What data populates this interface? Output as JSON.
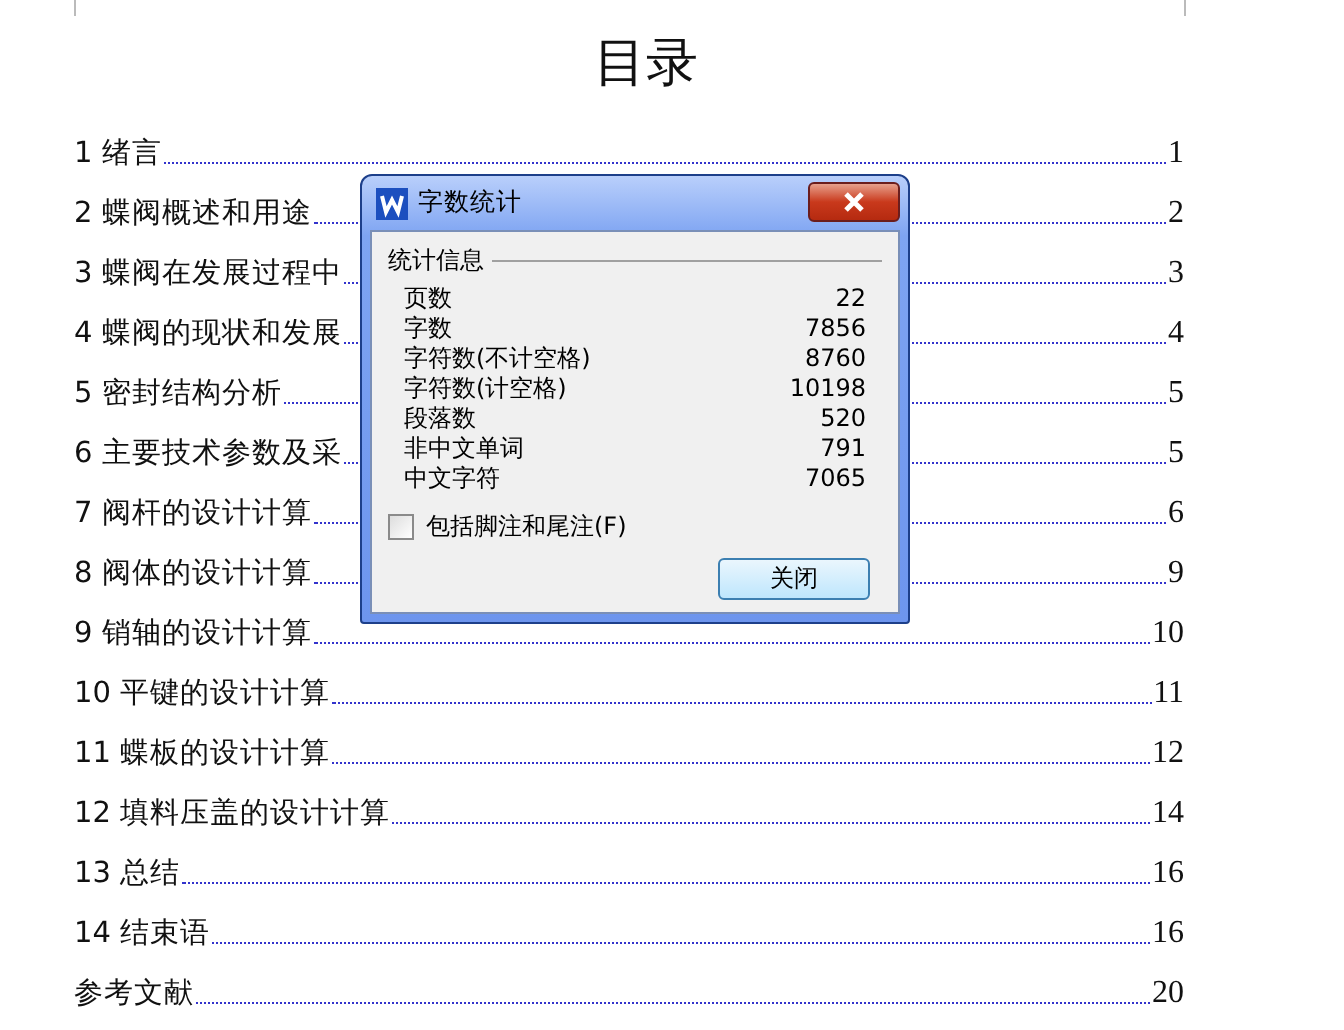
{
  "document": {
    "title": "目录",
    "toc": [
      {
        "label": "1 绪言",
        "page": "1"
      },
      {
        "label": "2 蝶阀概述和用途",
        "page": "2"
      },
      {
        "label": "3 蝶阀在发展过程中",
        "page": "3"
      },
      {
        "label": "4 蝶阀的现状和发展",
        "page": "4"
      },
      {
        "label": "5 密封结构分析",
        "page": "5"
      },
      {
        "label": "6 主要技术参数及采",
        "page": "5"
      },
      {
        "label": "7 阀杆的设计计算",
        "page": "6"
      },
      {
        "label": "8 阀体的设计计算",
        "page": "9"
      },
      {
        "label": "9 销轴的设计计算",
        "page": "10"
      },
      {
        "label": "10 平键的设计计算",
        "page": "11"
      },
      {
        "label": "11 蝶板的设计计算",
        "page": "12"
      },
      {
        "label": "12 填料压盖的设计计算",
        "page": "14"
      },
      {
        "label": "13 总结",
        "page": "16"
      },
      {
        "label": "14 结束语",
        "page": "16"
      },
      {
        "label": "参考文献",
        "page": "20"
      }
    ]
  },
  "dialog": {
    "title": "字数统计",
    "section": "统计信息",
    "stats": [
      {
        "label": "页数",
        "value": "22"
      },
      {
        "label": "字数",
        "value": "7856"
      },
      {
        "label": "字符数(不计空格)",
        "value": "8760"
      },
      {
        "label": "字符数(计空格)",
        "value": "10198"
      },
      {
        "label": "段落数",
        "value": "520"
      },
      {
        "label": "非中文单词",
        "value": "791"
      },
      {
        "label": "中文字符",
        "value": "7065"
      }
    ],
    "checkbox": {
      "label": "包括脚注和尾注(F)",
      "checked": false
    },
    "close_button": "关闭"
  }
}
